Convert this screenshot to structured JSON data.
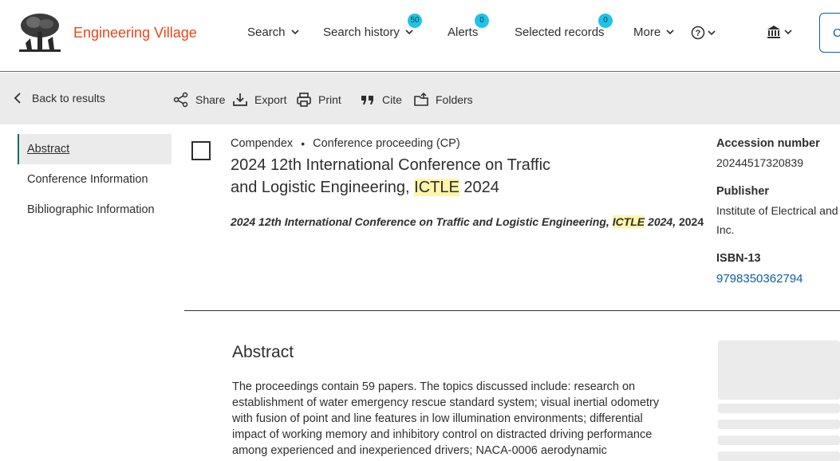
{
  "header": {
    "brand": "Engineering Village",
    "nav": [
      {
        "label": "Search"
      },
      {
        "label": "Search history",
        "badge": "50"
      },
      {
        "label": "Alerts",
        "badge": "0"
      },
      {
        "label": "Selected records",
        "badge": "0"
      },
      {
        "label": "More"
      }
    ],
    "cut_button_label": "C",
    "accent_color": "#e9461c",
    "badge_color": "#1ec4e8"
  },
  "toolbar": {
    "back_label": "Back to results",
    "actions": [
      {
        "label": "Share",
        "icon": "share-icon"
      },
      {
        "label": "Export",
        "icon": "download-icon"
      },
      {
        "label": "Print",
        "icon": "print-icon"
      },
      {
        "label": "Cite",
        "icon": "quote-icon"
      },
      {
        "label": "Folders",
        "icon": "folder-icon"
      }
    ]
  },
  "sidebar": {
    "items": [
      {
        "label": "Abstract",
        "active": true
      },
      {
        "label": "Conference Information",
        "active": false
      },
      {
        "label": "Bibliographic Information",
        "active": false
      }
    ]
  },
  "record": {
    "database": "Compendex",
    "doc_type": "Conference proceeding (CP)",
    "title_part1": "2024 12th International Conference on Traffic and Logistic Engineering,",
    "title_highlight": "ICTLE",
    "title_part2": "2024",
    "source_part1": "2024 12th International Conference on Traffic and Logistic Engineering,",
    "source_highlight": "ICTLE",
    "source_part2": "2024,",
    "source_year": "2024"
  },
  "details": {
    "accession_label": "Accession number",
    "accession_value": "20244517320839",
    "publisher_label": "Publisher",
    "publisher_line1": "Institute of Electrical and",
    "publisher_line2": "Inc.",
    "isbn_label": "ISBN-13",
    "isbn_value": "9798350362794",
    "link_color": "#0a5eab"
  },
  "abstract": {
    "heading": "Abstract",
    "lines": [
      "The proceedings contain 59 papers. The topics discussed include: research on",
      "establishment of water emergency rescue standard system; visual inertial odometry",
      "with fusion of point and line features in low illumination environments; differential",
      "impact of working memory and inhibitory control on distracted driving performance",
      "among experienced and inexperienced drivers; NACA-0006 aerodynamic"
    ]
  }
}
